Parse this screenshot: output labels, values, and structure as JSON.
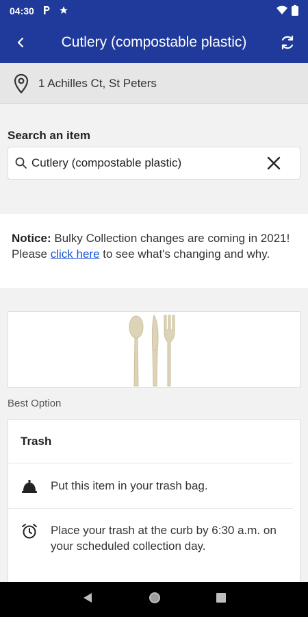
{
  "status_bar": {
    "time": "04:30",
    "app_icons": [
      "parking-icon",
      "star-icon"
    ],
    "system_icons": [
      "wifi-icon",
      "battery-icon"
    ]
  },
  "app_bar": {
    "title": "Cutlery (compostable plastic)",
    "back_icon": "back-chevron-icon",
    "refresh_icon": "refresh-icon"
  },
  "address": {
    "text": "1 Achilles Ct, St Peters",
    "icon": "location-pin-icon"
  },
  "search": {
    "label": "Search an item",
    "value": "Cutlery (compostable plastic)",
    "search_icon": "search-icon",
    "clear_icon": "close-icon"
  },
  "notice": {
    "bold": "Notice:",
    "text_before": "Bulky Collection changes are coming in 2021! Please",
    "link": "click here",
    "text_after": "to see what's changing and why."
  },
  "item_image": {
    "subject": "cutlery-illustration"
  },
  "best_option": {
    "label": "Best Option",
    "title": "Trash",
    "steps": [
      {
        "icon": "bell-icon",
        "text": "Put this item in your trash bag."
      },
      {
        "icon": "alarm-clock-icon",
        "text": "Place your trash at the curb by 6:30 a.m. on your scheduled collection day."
      }
    ]
  },
  "nav_bar": {
    "buttons": [
      "back-triangle-icon",
      "home-circle-icon",
      "recents-square-icon"
    ]
  },
  "colors": {
    "primary": "#1f3a9a",
    "link": "#1a56d6",
    "background": "#f2f2f2"
  }
}
